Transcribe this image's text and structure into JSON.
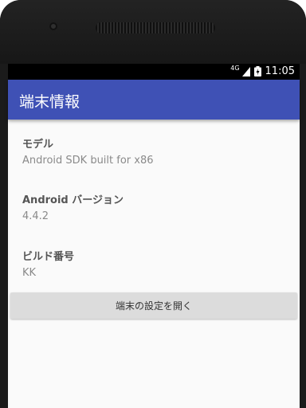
{
  "status_bar": {
    "network": "4G",
    "time": "11:05",
    "signal_icon": "signal-icon",
    "battery_icon": "battery-charging-icon"
  },
  "app_bar": {
    "title": "端末情報",
    "color": "#3f51b5"
  },
  "info": {
    "model": {
      "label": "モデル",
      "value": "Android SDK built for x86"
    },
    "version": {
      "label": "Android バージョン",
      "value": "4.4.2"
    },
    "build": {
      "label": "ビルド番号",
      "value": "KK"
    }
  },
  "actions": {
    "open_settings_label": "端末の設定を開く"
  }
}
